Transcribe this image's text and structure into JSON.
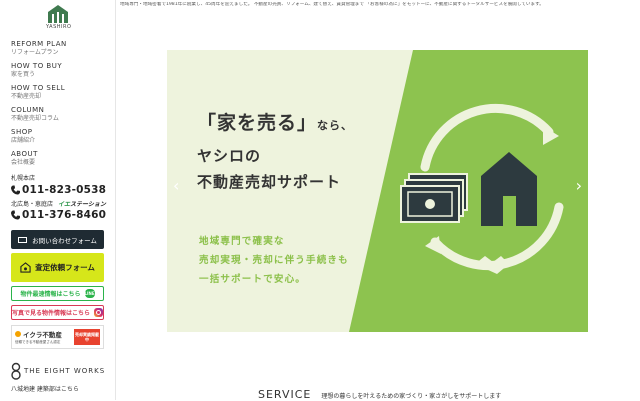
{
  "brand": {
    "logo_text": "YASHIRO"
  },
  "intro_text": "地域専門・地域密着で1981年に創業し、45周年を迎えました。 不動産の売買、リフォーム、建て替え、賃貸管理まで 「お客様の為に」をモットーに、不動産に関するトータルサービスを展開しています。",
  "nav": [
    {
      "en": "REFORM PLAN",
      "jp": "リフォームプラン"
    },
    {
      "en": "HOW TO BUY",
      "jp": "家を買う"
    },
    {
      "en": "HOW TO SELL",
      "jp": "不動産売却"
    },
    {
      "en": "COLUMN",
      "jp": "不動産売却コラム"
    },
    {
      "en": "SHOP",
      "jp": "店舗紹介"
    },
    {
      "en": "ABOUT",
      "jp": "会社概要"
    }
  ],
  "shops": [
    {
      "name": "札幌本店",
      "tel": "011-823-0538"
    },
    {
      "name": "北広島・恵庭店",
      "tel": "011-376-8460",
      "badge_a": "イエ",
      "badge_b": "ステーション"
    }
  ],
  "buttons": {
    "contact": "お問い合わせフォーム",
    "assess": "査定依頼フォーム",
    "line": "物件最速情報はこちら",
    "line_icon": "LINE",
    "insta": "写真で見る物件情報はこちら"
  },
  "ikura": {
    "title": "イクラ不動産",
    "sub": "信頼できる不動産屋さん認定",
    "badge": "売却実績掲載中"
  },
  "eight": {
    "name": "THE EIGHT WORKS",
    "sub": "八城地建 建築部はこちら"
  },
  "hero": {
    "line1_a": "「家を売る」",
    "line1_b": "なら、",
    "line2": "ヤシロの",
    "line3": "不動産売却サポート",
    "sub1": "地域専門で確実な",
    "sub2": "売却実現・売却に伴う手続きも",
    "sub3": "一括サポートで安心。",
    "arrow_prev": "‹",
    "arrow_next": "›"
  },
  "service": {
    "en": "SERVICE",
    "jp": "理想の暮らしを叶えるための家づくり・家さがしをサポートします"
  },
  "colors": {
    "accent_green": "#8dc34f",
    "lime": "#d6e61a",
    "dark": "#1f2b33",
    "line_green": "#2bb34a",
    "insta_pink": "#d83a55"
  }
}
